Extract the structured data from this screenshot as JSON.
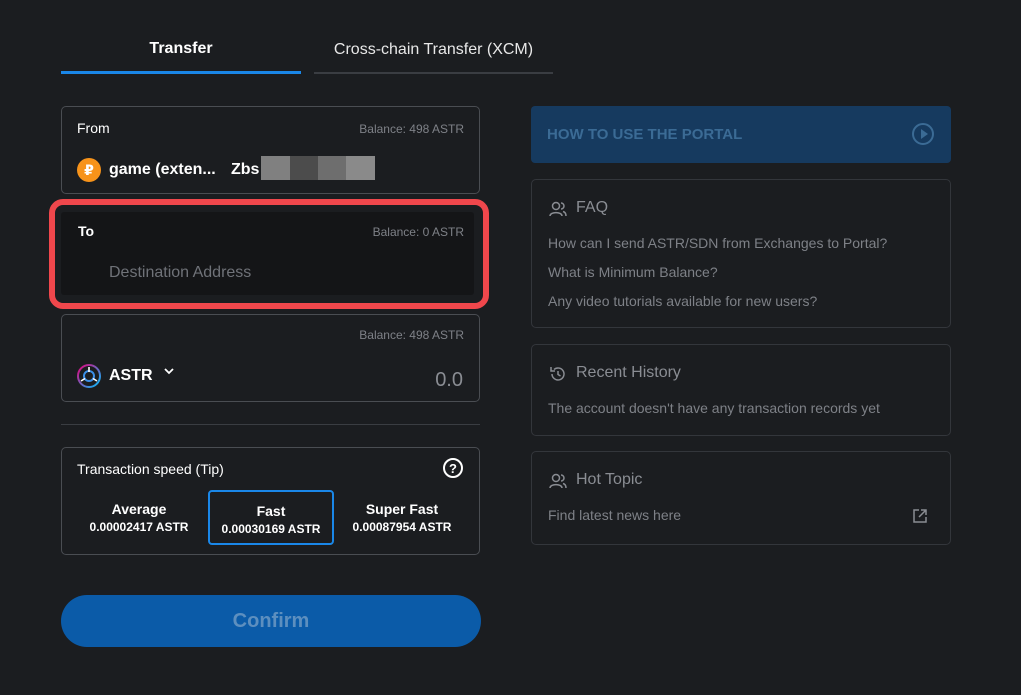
{
  "tabs": {
    "transfer": "Transfer",
    "xcm": "Cross-chain Transfer (XCM)"
  },
  "from": {
    "label": "From",
    "balance": "Balance: 498 ASTR",
    "account_name": "game (exten...",
    "address_prefix": "Zbs"
  },
  "to": {
    "label": "To",
    "balance": "Balance: 0 ASTR",
    "placeholder": "Destination Address"
  },
  "amount": {
    "balance": "Balance: 498 ASTR",
    "token": "ASTR",
    "placeholder": "0.0"
  },
  "speed": {
    "label": "Transaction speed (Tip)",
    "options": [
      {
        "name": "Average",
        "value": "0.00002417 ASTR"
      },
      {
        "name": "Fast",
        "value": "0.00030169 ASTR"
      },
      {
        "name": "Super Fast",
        "value": "0.00087954 ASTR"
      }
    ],
    "selected": "Fast"
  },
  "confirm_label": "Confirm",
  "howto": "HOW TO USE THE PORTAL",
  "faq": {
    "title": "FAQ",
    "items": [
      "How can I send ASTR/SDN from Exchanges to Portal?",
      "What is Minimum Balance?",
      "Any video tutorials available for new users?"
    ]
  },
  "history": {
    "title": "Recent History",
    "empty": "The account doesn't have any transaction records yet"
  },
  "hot_topic": {
    "title": "Hot Topic",
    "link": "Find latest news here"
  },
  "colors": {
    "accent": "#1a87e8",
    "highlight": "#f0474c",
    "background": "#1b1d20"
  }
}
